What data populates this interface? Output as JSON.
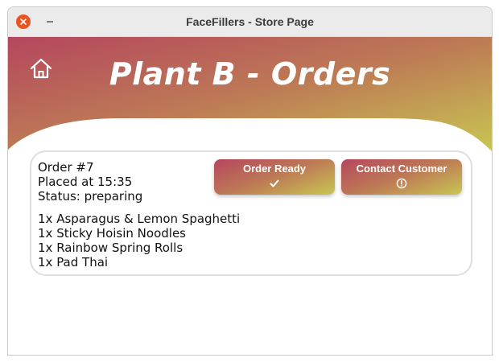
{
  "window": {
    "title": "FaceFillers - Store Page"
  },
  "header": {
    "title": "Plant B - Orders",
    "home_icon": "home-icon",
    "gradient_colors": [
      "#b5465e",
      "#bd7a55",
      "#c8c652"
    ]
  },
  "order": {
    "number_text": "Order #7",
    "placed_text": "Placed at 15:35",
    "status_text": "Status: preparing",
    "items": [
      "1x Asparagus & Lemon Spaghetti",
      "1x Sticky Hoisin Noodles",
      "1x Rainbow Spring Rolls",
      "1x Pad Thai"
    ],
    "actions": {
      "ready_label": "Order Ready",
      "ready_icon": "checkmark-icon",
      "contact_label": "Contact Customer",
      "contact_icon": "alert-circle-icon"
    }
  }
}
